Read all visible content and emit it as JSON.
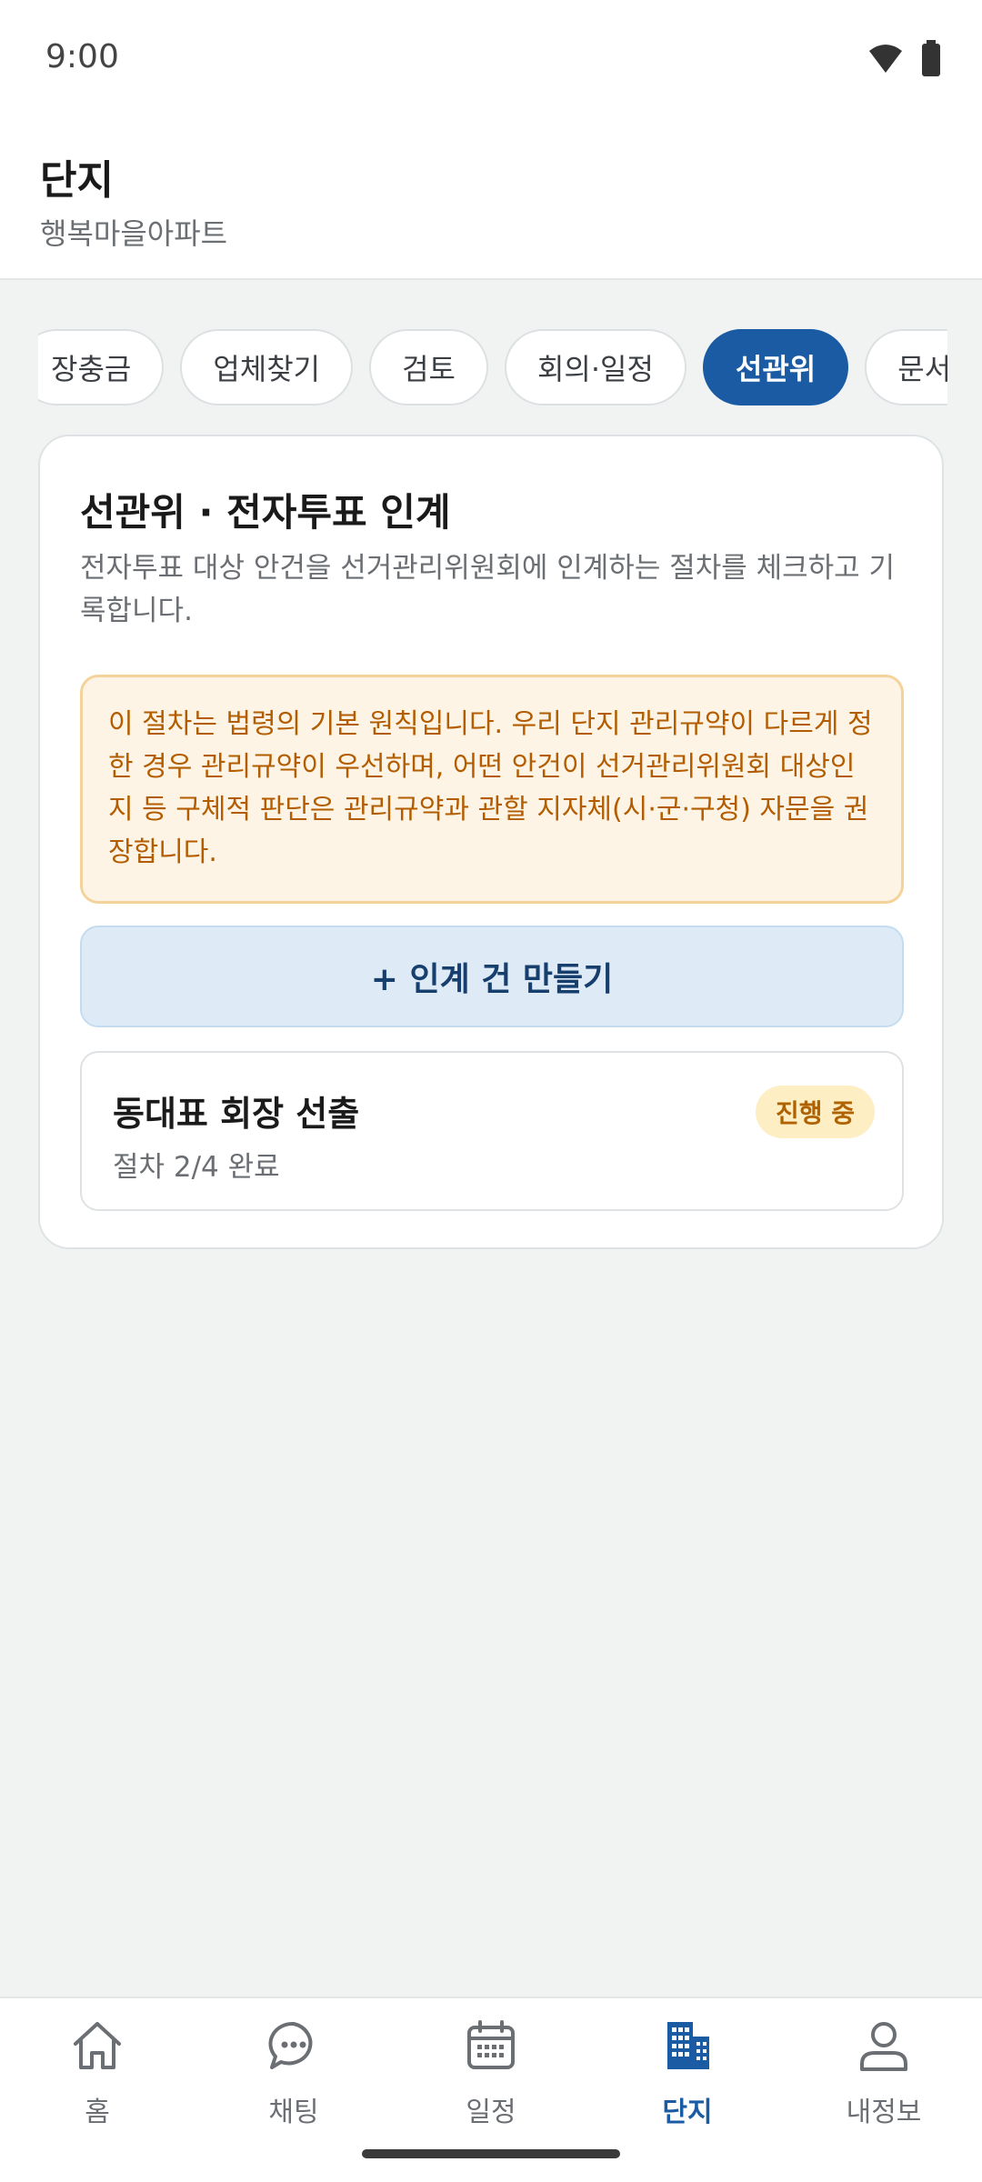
{
  "status_bar": {
    "time": "9:00"
  },
  "header": {
    "title": "단지",
    "subtitle": "행복마을아파트"
  },
  "tabs": [
    {
      "label": "장충금",
      "active": false
    },
    {
      "label": "업체찾기",
      "active": false
    },
    {
      "label": "검토",
      "active": false
    },
    {
      "label": "회의·일정",
      "active": false
    },
    {
      "label": "선관위",
      "active": true
    },
    {
      "label": "문서",
      "active": false
    }
  ],
  "card": {
    "title": "선관위 · 전자투표 인계",
    "description": "전자투표 대상 안건을 선거관리위원회에 인계하는 절차를 체크하고 기록합니다.",
    "notice": "이 절차는 법령의 기본 원칙입니다. 우리 단지 관리규약이 다르게 정한 경우 관리규약이 우선하며, 어떤 안건이 선거관리위원회 대상인지 등 구체적 판단은 관리규약과 관할 지자체(시·군·구청) 자문을 권장합니다.",
    "create_button": "+ 인계 건 만들기",
    "items": [
      {
        "title": "동대표 회장 선출",
        "progress": "절차 2/4 완료",
        "status": "진행 중"
      }
    ]
  },
  "bottom_nav": [
    {
      "label": "홈",
      "icon": "home-icon",
      "active": false
    },
    {
      "label": "채팅",
      "icon": "chat-icon",
      "active": false
    },
    {
      "label": "일정",
      "icon": "calendar-icon",
      "active": false
    },
    {
      "label": "단지",
      "icon": "building-icon",
      "active": true
    },
    {
      "label": "내정보",
      "icon": "person-icon",
      "active": false
    }
  ],
  "colors": {
    "accent": "#1a5ba3",
    "notice_text": "#b35d00",
    "badge_bg": "#fdeec3"
  }
}
